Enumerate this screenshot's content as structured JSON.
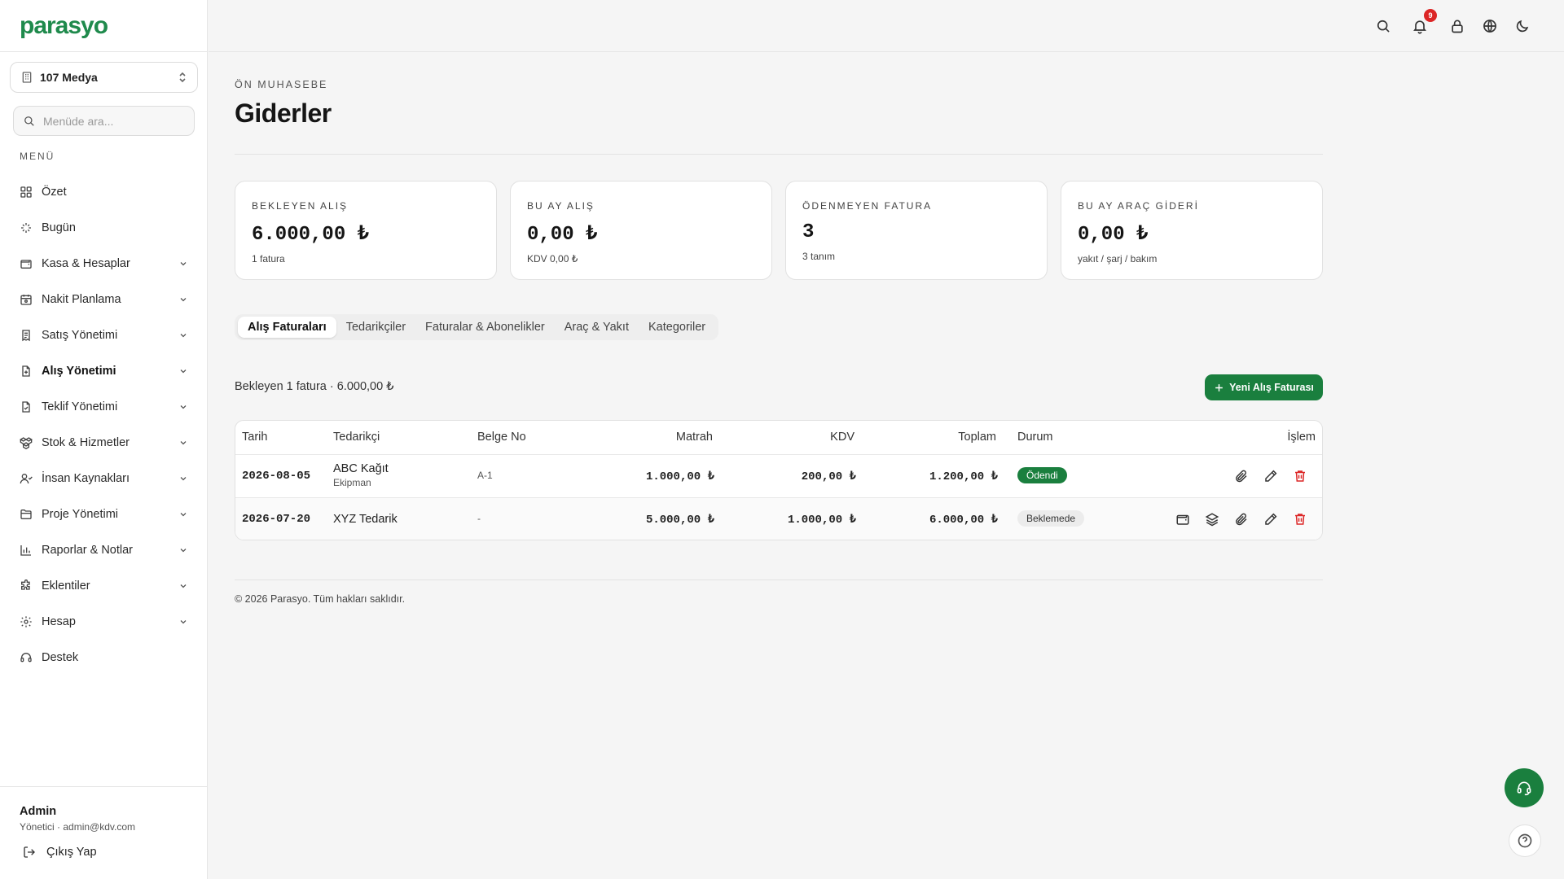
{
  "brand": {
    "logo_text": "parasyo",
    "color": "#1f8a4c"
  },
  "company": {
    "name": "107 Medya"
  },
  "menu_search": {
    "placeholder": "Menüde ara..."
  },
  "menu_header": "MENÜ",
  "nav": [
    {
      "label": "Özet",
      "icon": "dashboard-icon",
      "expandable": false
    },
    {
      "label": "Bugün",
      "icon": "sparkle-icon",
      "expandable": false
    },
    {
      "label": "Kasa & Hesaplar",
      "icon": "wallet-icon",
      "expandable": true
    },
    {
      "label": "Nakit Planlama",
      "icon": "calendar-icon",
      "expandable": true
    },
    {
      "label": "Satış Yönetimi",
      "icon": "receipt-icon",
      "expandable": true
    },
    {
      "label": "Alış Yönetimi",
      "icon": "file-plus-icon",
      "expandable": true,
      "active": true
    },
    {
      "label": "Teklif Yönetimi",
      "icon": "file-check-icon",
      "expandable": true
    },
    {
      "label": "Stok & Hizmetler",
      "icon": "boxes-icon",
      "expandable": true
    },
    {
      "label": "İnsan Kaynakları",
      "icon": "users-icon",
      "expandable": true
    },
    {
      "label": "Proje Yönetimi",
      "icon": "folder-icon",
      "expandable": true
    },
    {
      "label": "Raporlar & Notlar",
      "icon": "bar-chart-icon",
      "expandable": true
    },
    {
      "label": "Eklentiler",
      "icon": "puzzle-icon",
      "expandable": true
    },
    {
      "label": "Hesap",
      "icon": "gear-icon",
      "expandable": true
    },
    {
      "label": "Destek",
      "icon": "headset-icon",
      "expandable": false
    }
  ],
  "user": {
    "name": "Admin",
    "role_line": "Yönetici · admin@kdv.com",
    "logout_label": "Çıkış Yap"
  },
  "topbar": {
    "notification_count": "9",
    "icons": [
      "search-icon",
      "bell-icon",
      "lock-icon",
      "globe-icon",
      "moon-icon"
    ]
  },
  "page": {
    "breadcrumb": "ÖN MUHASEBE",
    "title": "Giderler"
  },
  "stats": [
    {
      "label": "BEKLEYEN ALIŞ",
      "value": "6.000,00 ₺",
      "sub": "1 fatura"
    },
    {
      "label": "BU AY ALIŞ",
      "value": "0,00 ₺",
      "sub": "KDV 0,00 ₺"
    },
    {
      "label": "ÖDENMEYEN FATURA",
      "value": "3",
      "sub": "3 tanım"
    },
    {
      "label": "BU AY ARAÇ GİDERİ",
      "value": "0,00 ₺",
      "sub": "yakıt / şarj / bakım"
    }
  ],
  "tabs": [
    {
      "label": "Alış Faturaları",
      "active": true
    },
    {
      "label": "Tedarikçiler",
      "active": false
    },
    {
      "label": "Faturalar & Abonelikler",
      "active": false
    },
    {
      "label": "Araç & Yakıt",
      "active": false
    },
    {
      "label": "Kategoriler",
      "active": false
    }
  ],
  "summary": "Bekleyen 1 fatura · 6.000,00 ₺",
  "new_button": "Yeni Alış Faturası",
  "table": {
    "headers": {
      "date": "Tarih",
      "supplier": "Tedarikçi",
      "doc": "Belge No",
      "base": "Matrah",
      "vat": "KDV",
      "total": "Toplam",
      "status": "Durum",
      "actions": "İşlem"
    },
    "rows": [
      {
        "date": "2026-08-05",
        "supplier": "ABC Kağıt",
        "category": "Ekipman",
        "doc": "A-1",
        "base": "1.000,00 ₺",
        "vat": "200,00 ₺",
        "total": "1.200,00 ₺",
        "status": "Ödendi",
        "actions": [
          "paperclip-icon",
          "pencil-icon",
          "trash-icon"
        ]
      },
      {
        "date": "2026-07-20",
        "supplier": "XYZ Tedarik",
        "category": "",
        "doc": "-",
        "base": "5.000,00 ₺",
        "vat": "1.000,00 ₺",
        "total": "6.000,00 ₺",
        "status": "Beklemede",
        "actions": [
          "wallet-icon",
          "layers-icon",
          "paperclip-icon",
          "pencil-icon",
          "trash-icon"
        ]
      }
    ]
  },
  "footer": "© 2026 Parasyo. Tüm hakları saklıdır.",
  "colors": {
    "accent": "#1a7f3e",
    "danger": "#dc2626"
  }
}
